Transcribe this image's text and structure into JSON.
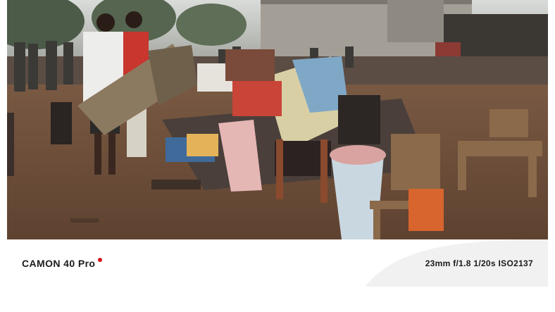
{
  "photo": {
    "description_icon": "street-scene-photo"
  },
  "watermark": {
    "brand": "CAMON 40 Pro",
    "specs": "23mm f/1.8 1/20s ISO2137",
    "dot_color": "#d7141c"
  }
}
